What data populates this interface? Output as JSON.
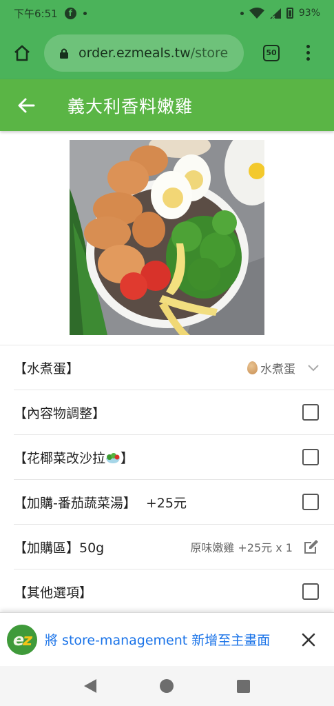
{
  "status_bar": {
    "time": "下午6:51",
    "battery": "93%"
  },
  "browser": {
    "url_host": "order.ezmeals.tw",
    "url_path": "/store",
    "tab_count": "50"
  },
  "header": {
    "title": "義大利香料嫩雞"
  },
  "options": [
    {
      "label": "【水煮蛋】",
      "selected": "水煮蛋"
    },
    {
      "label": "【內容物調整】"
    },
    {
      "label": "【花椰菜改沙拉",
      "label_end": "】"
    },
    {
      "label": "【加購-番茄蔬菜湯】",
      "extra": "+25元"
    },
    {
      "label": "【加購區】50g",
      "summary": "原味嫩雞 +25元 x 1"
    },
    {
      "label": "【其他選項】"
    }
  ],
  "install_banner": {
    "text": "將 store-management 新增至主畫面"
  },
  "colors": {
    "primary": "#5ab545",
    "status": "#4bb35a",
    "link": "#1a73e8"
  }
}
